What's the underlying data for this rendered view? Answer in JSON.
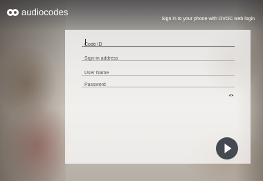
{
  "header": {
    "brand": "audiocodes",
    "tagline": "Sign in to your phone with OVOC web login"
  },
  "form": {
    "code_id": {
      "placeholder": "Code ID",
      "value": ""
    },
    "sign_in_address": {
      "placeholder": "Sign-in address",
      "value": ""
    },
    "user_name": {
      "placeholder": "User Name",
      "value": ""
    },
    "password": {
      "placeholder": "Password",
      "value": ""
    }
  },
  "icons": {
    "logo": "audiocodes-logo-icon",
    "show_password": "eye-icon",
    "submit": "arrow-right-icon"
  },
  "colors": {
    "panel": "#ffffff",
    "submit_button": "#454a52",
    "text": "#333333"
  }
}
